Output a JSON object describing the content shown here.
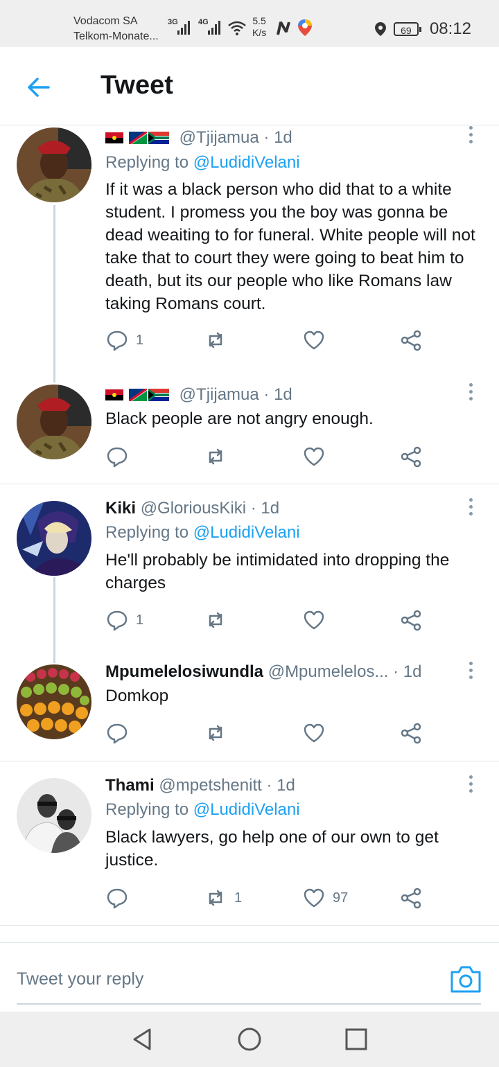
{
  "status_bar": {
    "carrier1": "Vodacom SA",
    "carrier2": "Telkom-Monate...",
    "sig1": "3G",
    "sig2": "4G",
    "speed_value": "5.5",
    "speed_unit": "K/s",
    "battery": "69",
    "time": "08:12"
  },
  "header": {
    "title": "Tweet"
  },
  "tweets": [
    {
      "handle": "@Tjijamua",
      "time": "· 1d",
      "replying_label": "Replying to",
      "replying_handle": "@LudidiVelani",
      "text": "If it was a black person who did that to a white student. I promess you the boy was gonna be dead weaiting to for funeral. White people will not take that to court they were going to beat him to death, but its our people who like Romans law taking Romans court.",
      "replies": "1",
      "retweets": "",
      "likes": ""
    },
    {
      "handle": "@Tjijamua",
      "time": "· 1d",
      "text": "Black people are not angry enough.",
      "replies": "",
      "retweets": "",
      "likes": ""
    },
    {
      "name": "Kiki",
      "handle": "@GloriousKiki",
      "time": "· 1d",
      "replying_label": "Replying to",
      "replying_handle": "@LudidiVelani",
      "text": "He'll probably be intimidated into dropping the charges",
      "replies": "1",
      "retweets": "",
      "likes": ""
    },
    {
      "name": "Mpumelelosiwundla",
      "handle": "@Mpumelelos...",
      "time": "· 1d",
      "text": "Domkop",
      "replies": "",
      "retweets": "",
      "likes": ""
    },
    {
      "name": "Thami",
      "handle": "@mpetshenitt",
      "time": "· 1d",
      "replying_label": "Replying to",
      "replying_handle": "@LudidiVelani",
      "text": "Black lawyers, go help one of our own to get justice.",
      "replies": "",
      "retweets": "1",
      "likes": "97"
    }
  ],
  "reply_bar": {
    "placeholder": "Tweet your reply"
  },
  "icons": {
    "back": "arrow-left-icon",
    "reply": "speech-bubble-icon",
    "retweet": "retweet-icon",
    "like": "heart-icon",
    "share": "share-icon",
    "more": "vertical-dots-icon",
    "camera": "camera-icon"
  },
  "colors": {
    "accent": "#1da1f2",
    "muted": "#657786",
    "text": "#14171a"
  }
}
